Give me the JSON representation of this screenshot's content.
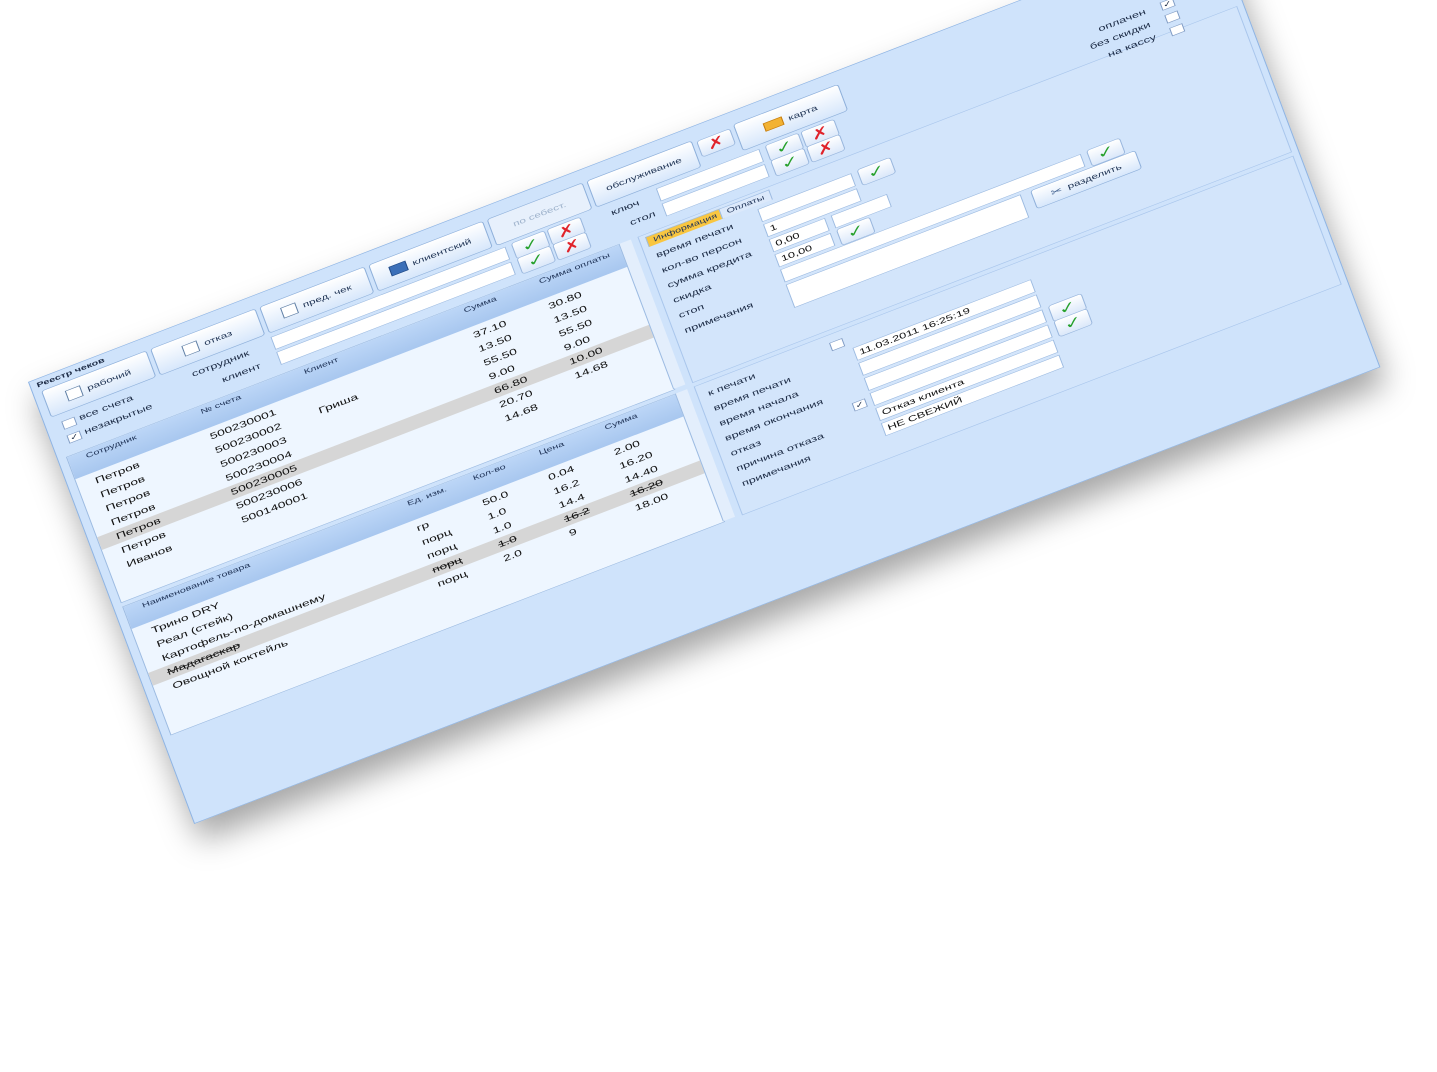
{
  "window": {
    "title": "Реестр чеков"
  },
  "toolbar": {
    "rabochiy": "рабочий",
    "otkaz": "отказ",
    "pred_chek": "пред. чек",
    "klientskiy": "клиентский",
    "po_sebest": "по себест.",
    "obsluzhivanie": "обслуживание",
    "karta": "карта"
  },
  "filters": {
    "vse_scheta": "все счета",
    "nezakrytye": "незакрытые",
    "sotrudnik": "сотрудник",
    "klient": "клиент",
    "klyuch": "ключ",
    "stol": "стол"
  },
  "checks_grid": {
    "headers": [
      "Сотрудник",
      "№ счета",
      "Клиент",
      "Сумма",
      "Сумма оплаты"
    ],
    "rows": [
      {
        "employee": "Петров",
        "num": "500230001",
        "client": "",
        "sum": "37.10",
        "paid": "30.80"
      },
      {
        "employee": "Петров",
        "num": "500230002",
        "client": "Гриша",
        "sum": "13.50",
        "paid": "13.50"
      },
      {
        "employee": "Петров",
        "num": "500230003",
        "client": "",
        "sum": "55.50",
        "paid": "55.50"
      },
      {
        "employee": "Петров",
        "num": "500230004",
        "client": "",
        "sum": "9.00",
        "paid": "9.00"
      },
      {
        "employee": "Петров",
        "num": "500230005",
        "client": "",
        "sum": "66.80",
        "paid": "10.00",
        "selected": true
      },
      {
        "employee": "Петров",
        "num": "500230006",
        "client": "",
        "sum": "20.70",
        "paid": "14.68"
      },
      {
        "employee": "Иванов",
        "num": "500140001",
        "client": "",
        "sum": "14.68",
        "paid": ""
      }
    ]
  },
  "items_grid": {
    "headers": [
      "Наименование товара",
      "Ед. изм.",
      "Кол-во",
      "Цена",
      "Сумма"
    ],
    "rows": [
      {
        "name": "Трино DRY",
        "unit": "гр",
        "qty": "50.0",
        "price": "0.04",
        "sum": "2.00"
      },
      {
        "name": "Реал (стейк)",
        "unit": "порц",
        "qty": "1.0",
        "price": "16.2",
        "sum": "16.20"
      },
      {
        "name": "Картофель-по-домашнему",
        "unit": "порц",
        "qty": "1.0",
        "price": "14.4",
        "sum": "14.40"
      },
      {
        "name": "Мадагаскар",
        "unit": "порц",
        "qty": "1.0",
        "price": "16.2",
        "sum": "16.20",
        "struck": true,
        "selected": true
      },
      {
        "name": "Овощной коктейль",
        "unit": "порц",
        "qty": "2.0",
        "price": "9",
        "sum": "18.00"
      }
    ]
  },
  "right_top": {
    "oplachen": "оплачен",
    "bez_skidki": "без скидки",
    "na_kassu": "на кассу",
    "tabs": [
      "Информация",
      "Оплаты"
    ],
    "vremya_pechati": "время печати",
    "kol_vo_person": "кол-во персон",
    "kol_vo_person_value": "1",
    "summa_kredita": "сумма кредита",
    "summa_kredita_value": "0,00",
    "skidka": "скидка",
    "skidka_value": "10,00",
    "stop": "стоп",
    "primechaniya": "примечания",
    "razdelit": "разделить"
  },
  "right_bottom": {
    "k_pechati": "к печати",
    "vremya_pechati": "время печати",
    "vremya_pechati_value": "11.03.2011 16:25:19",
    "vremya_nachala": "время начала",
    "vremya_okonchaniya": "время окончания",
    "otkaz": "отказ",
    "prichina_otkaza": "причина отказа",
    "prichina_otkaza_value": "Отказ клиента",
    "primechaniya": "примечания",
    "primechaniya_value": "НЕ СВЕЖИЙ"
  },
  "icons": {
    "close": "close-icon",
    "ok": "checkmark-icon",
    "cancel": "cross-icon",
    "document": "document-icon",
    "floppy": "floppy-icon",
    "card": "card-icon",
    "scissors": "scissors-icon"
  },
  "colors": {
    "window_bg": "#cfe3fb",
    "grid_bg": "#eef6ff",
    "header_bg": "#bcd6f7",
    "selected_row": "#d6d6d6",
    "active_tab": "#f9c640",
    "ok_green": "#27a12c",
    "cancel_red": "#e0232b",
    "close_red": "#e84b45"
  }
}
